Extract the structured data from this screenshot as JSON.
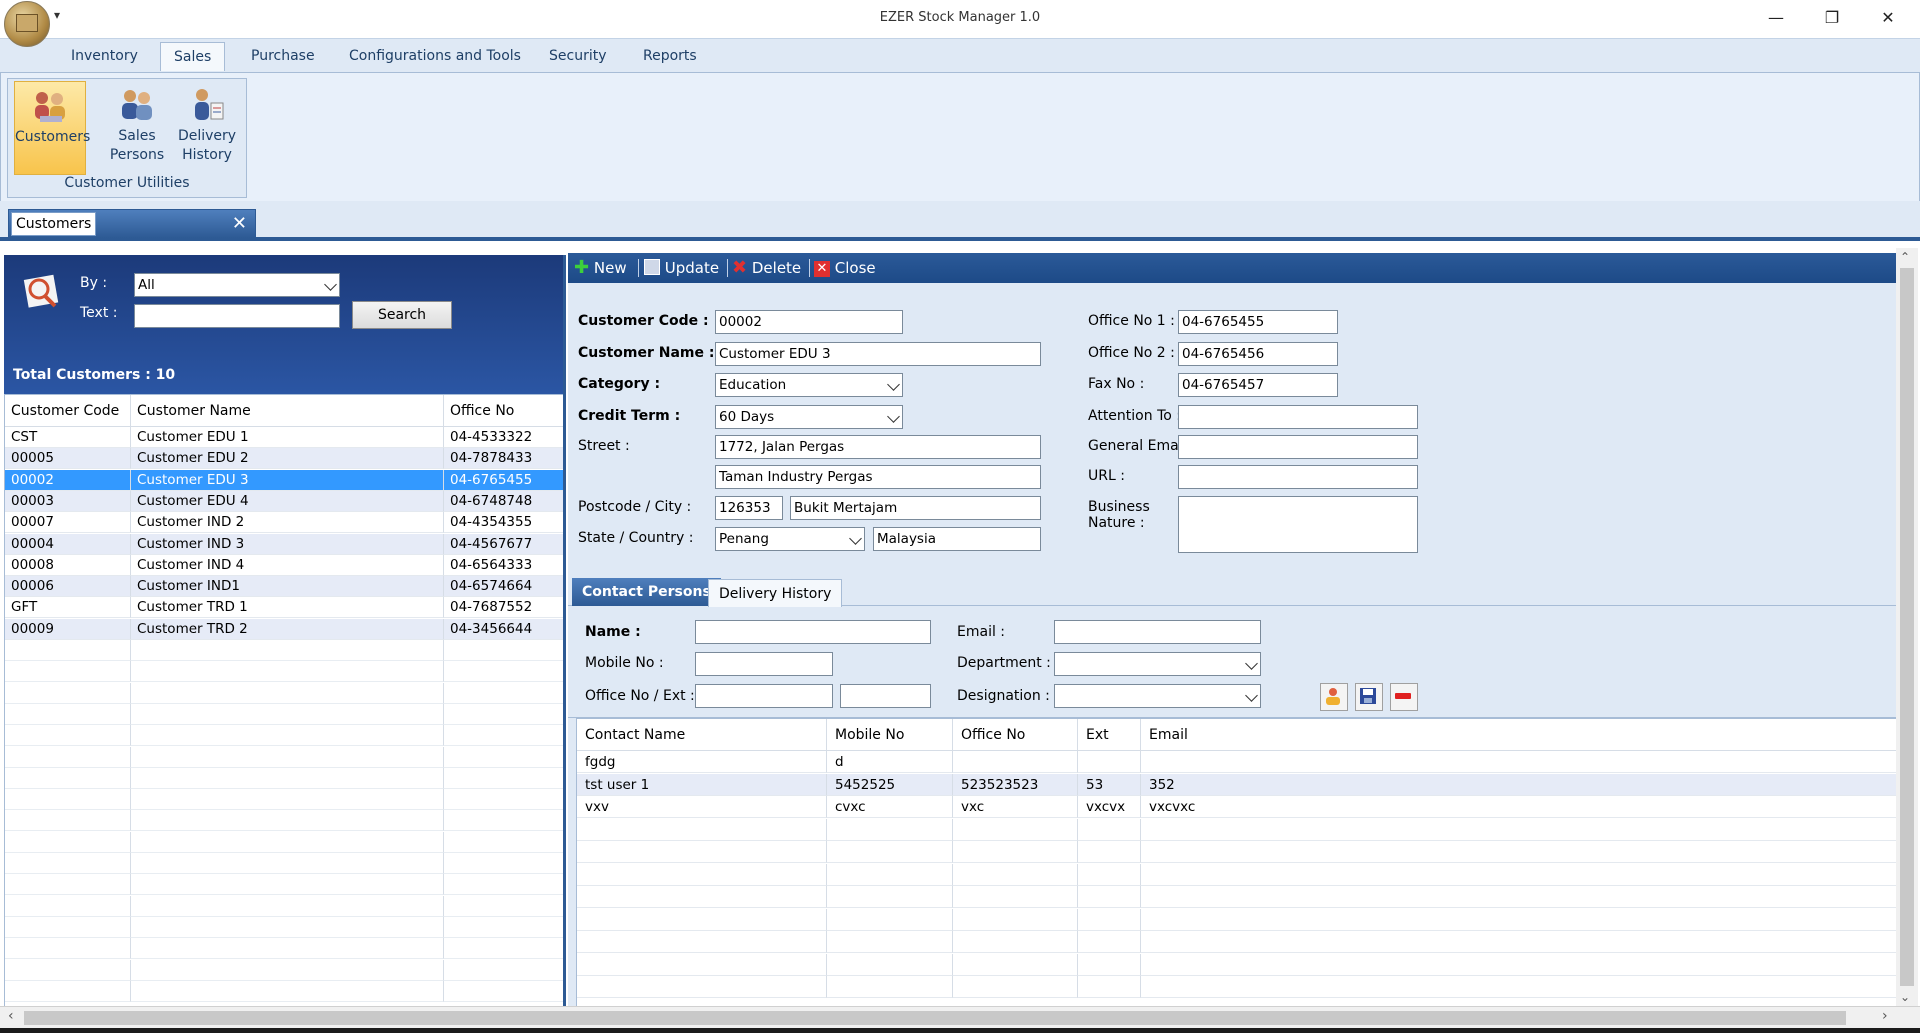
{
  "window": {
    "title": "EZER Stock Manager 1.0",
    "qat_glyph": "▾",
    "minimize_glyph": "—",
    "restore_glyph": "❐",
    "close_glyph": "✕"
  },
  "ribbon": {
    "tabs": [
      "Inventory",
      "Sales",
      "Purchase",
      "Configurations and Tools",
      "Security",
      "Reports"
    ],
    "active_tab": "Sales",
    "group": {
      "label": "Customer Utilities",
      "buttons": [
        {
          "label": "Customers",
          "icon": "customers-icon"
        },
        {
          "label": "Sales\nPersons",
          "icon": "sales-persons-icon"
        },
        {
          "label": "Delivery\nHistory",
          "icon": "delivery-history-icon"
        }
      ]
    }
  },
  "document_tab": {
    "label": "Customers",
    "close_glyph": "✕"
  },
  "search": {
    "by_label": "By :",
    "by_value": "All",
    "text_label": "Text :",
    "text_value": "",
    "button": "Search",
    "total_label": "Total Customers : 10"
  },
  "customer_grid": {
    "columns": [
      "Customer Code",
      "Customer Name",
      "Office No"
    ],
    "rows": [
      [
        "CST",
        "Customer EDU 1",
        "04-4533322"
      ],
      [
        "00005",
        "Customer EDU 2",
        "04-7878433"
      ],
      [
        "00002",
        "Customer EDU 3",
        "04-6765455"
      ],
      [
        "00003",
        "Customer EDU 4",
        "04-6748748"
      ],
      [
        "00007",
        "Customer IND 2",
        "04-4354355"
      ],
      [
        "00004",
        "Customer IND 3",
        "04-4567677"
      ],
      [
        "00008",
        "Customer IND 4",
        "04-6564333"
      ],
      [
        "00006",
        "Customer IND1",
        "04-6574664"
      ],
      [
        "GFT",
        "Customer TRD 1",
        "04-7687552"
      ],
      [
        "00009",
        "Customer TRD 2",
        "04-3456644"
      ]
    ],
    "selected_index": 2
  },
  "toolbar": {
    "new": "New",
    "update": "Update",
    "delete": "Delete",
    "close": "Close"
  },
  "form": {
    "customer_code_label": "Customer Code :",
    "customer_code": "00002",
    "customer_name_label": "Customer Name :",
    "customer_name": "Customer EDU 3",
    "category_label": "Category :",
    "category": "Education",
    "credit_term_label": "Credit Term :",
    "credit_term": "60 Days",
    "street_label": "Street :",
    "street1": "1772, Jalan Pergas",
    "street2": "Taman Industry Pergas",
    "postcode_city_label": "Postcode / City :",
    "postcode": "126353",
    "city": "Bukit Mertajam",
    "state_country_label": "State / Country :",
    "state": "Penang",
    "country": "Malaysia",
    "office1_label": "Office No 1 :",
    "office1": "04-6765455",
    "office2_label": "Office No 2 :",
    "office2": "04-6765456",
    "fax_label": "Fax No :",
    "fax": "04-6765457",
    "attention_label": "Attention To :",
    "attention": "",
    "email_label": "General Email :",
    "email": "",
    "url_label": "URL :",
    "url": "",
    "business_label": "Business\nNature :",
    "business": ""
  },
  "contact_tabs": {
    "active": "Contact Persons",
    "other": "Delivery History"
  },
  "contact_form": {
    "name_label": "Name :",
    "name": "",
    "mobile_label": "Mobile No :",
    "mobile": "",
    "office_ext_label": "Office No / Ext :",
    "office": "",
    "ext": "",
    "email_label": "Email :",
    "email": "",
    "department_label": "Department :",
    "department": "",
    "designation_label": "Designation :",
    "designation": ""
  },
  "contact_grid": {
    "columns": [
      "Contact Name",
      "Mobile No",
      "Office No",
      "Ext",
      "Email"
    ],
    "rows": [
      [
        "fgdg",
        "d",
        "",
        "",
        ""
      ],
      [
        "tst user 1",
        "5452525",
        "523523523",
        "53",
        "352"
      ],
      [
        "vxv",
        "cvxc",
        "vxc",
        "vxcvx",
        "vxcvxc"
      ]
    ]
  },
  "colors": {
    "ribbon": "#dfe9f5",
    "panel_blue": "#2b56a4",
    "selection": "#3399ff",
    "alt_row": "#e6ebf7"
  }
}
